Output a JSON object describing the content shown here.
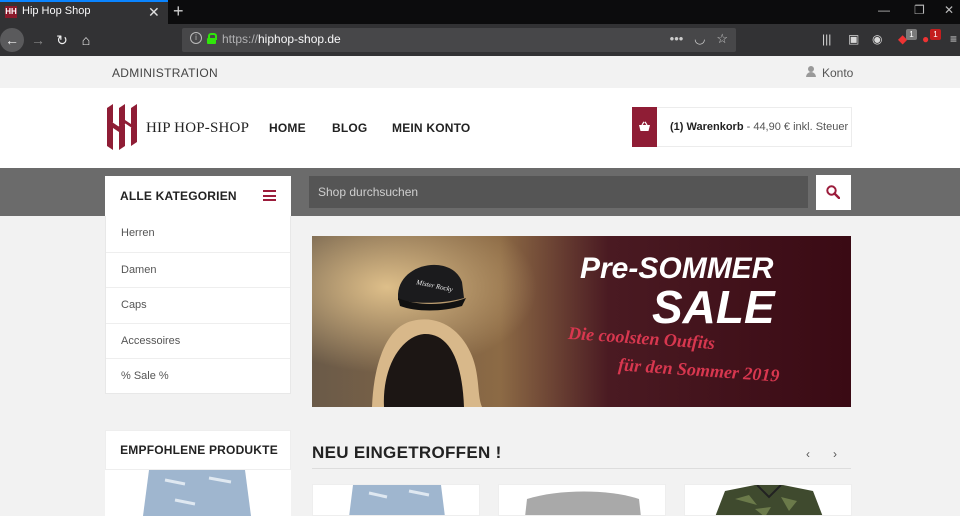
{
  "browser": {
    "tab_title": "Hip Hop Shop",
    "favicon_text": "HH",
    "new_tab": "+",
    "url_scheme": "https://",
    "url_host": "hiphop-shop.de",
    "badge_a": "1",
    "badge_b": "1"
  },
  "topbar": {
    "admin_label": "ADMINISTRATION",
    "konto_label": "Konto"
  },
  "header": {
    "logo_text": "HIP HOP-SHOP",
    "nav": [
      "HOME",
      "BLOG",
      "MEIN KONTO"
    ],
    "cart_label": "(1) Warenkorb",
    "cart_info": " - 44,90 € inkl. Steuer",
    "cart_color": "#8f1d35"
  },
  "search": {
    "placeholder": "Shop durchsuchen"
  },
  "categories": {
    "title": "ALLE KATEGORIEN",
    "items": [
      "Herren",
      "Damen",
      "Caps",
      "Accessoires",
      "% Sale %"
    ]
  },
  "banner": {
    "line1": "Pre-SOMMER",
    "line2": "SALE",
    "line3": "Die coolsten Outfits",
    "line4": "für den Sommer 2019",
    "cap_text": "Mister Rocky"
  },
  "recommended": {
    "title": "EMPFOHLENE PRODUKTE"
  },
  "new_arrivals": {
    "title": "NEU EINGETROFFEN !",
    "prev": "‹",
    "next": "›"
  }
}
